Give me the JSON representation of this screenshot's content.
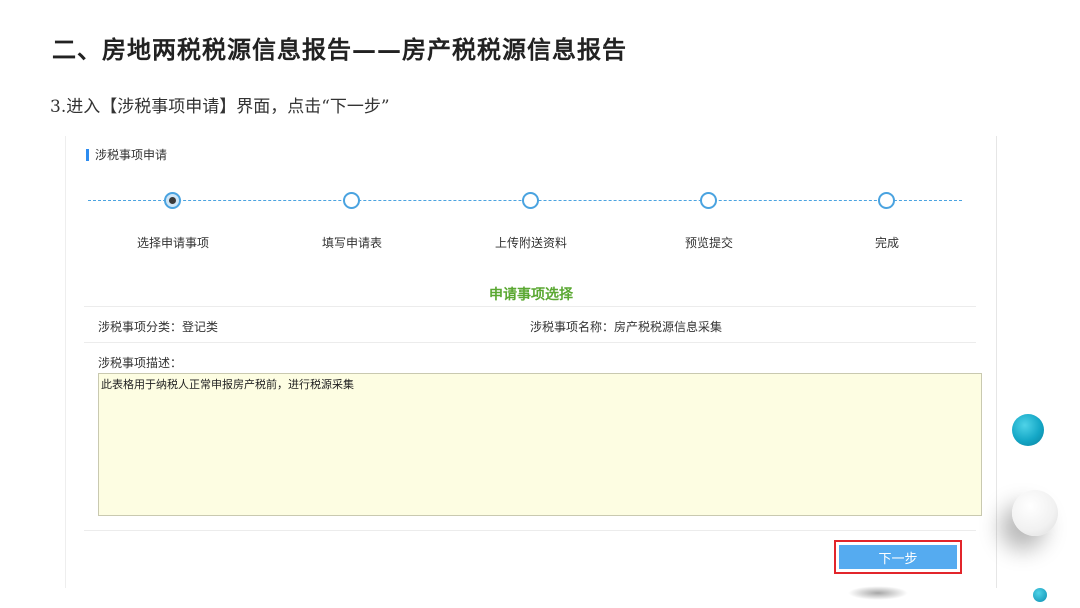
{
  "slide": {
    "title": "二、房地两税税源信息报告——房产税税源信息报告",
    "step_text": "3.进入【涉税事项申请】界面，点击“下一步”"
  },
  "panel": {
    "header": "涉税事项申请",
    "steps": [
      {
        "label": "选择申请事项",
        "state": "active",
        "marker": "1"
      },
      {
        "label": "填写申请表",
        "state": "pending"
      },
      {
        "label": "上传附送资料",
        "state": "pending"
      },
      {
        "label": "预览提交",
        "state": "pending"
      },
      {
        "label": "完成",
        "state": "pending"
      }
    ],
    "section_title": "申请事项选择",
    "category": "涉税事项分类：登记类",
    "item_name": "涉税事项名称：房产税税源信息采集",
    "description_label": "涉税事项描述：",
    "description_text": "此表格用于纳税人正常申报房产税前，进行税源采集",
    "next_button": "下一步"
  },
  "colors": {
    "accent_blue": "#55abf0",
    "step_line": "#4aa3e0",
    "section_green": "#5aa832",
    "highlight_red": "#e2252b",
    "desc_bg": "#fdfde2"
  }
}
